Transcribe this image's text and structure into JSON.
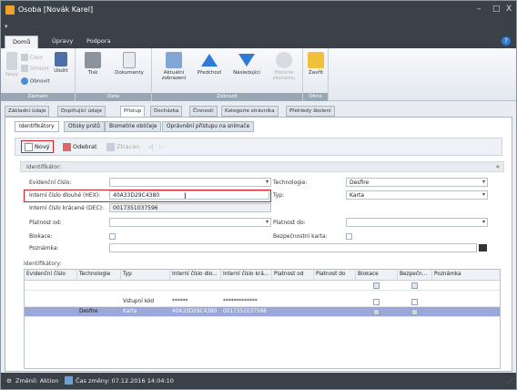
{
  "window": {
    "title": "Osoba [Novák Karel]",
    "controls": [
      "–",
      "□",
      "X"
    ]
  },
  "ribbon_tabs": [
    "Domů",
    "Úpravy",
    "Podpora"
  ],
  "help_label": "?",
  "ribbon": {
    "zaznam": {
      "label": "Záznam",
      "novy": "Nový",
      "copy": "Copy",
      "smazat": "Smazat",
      "ulozit": "Uložit",
      "obnovit": "Obnovit"
    },
    "data": {
      "label": "Data",
      "tisk": "Tisk",
      "dokumenty": "Dokumenty"
    },
    "zobrazit": {
      "label": "Zobrazit",
      "aktualni": "Aktuální zobrazení",
      "predchozi": "Předchozí",
      "nasledujici": "Následující",
      "historie": "Historie záznamu"
    },
    "okno": {
      "label": "Okno",
      "zavrit": "Zavřít"
    }
  },
  "doc_tabs": [
    "Základní údaje",
    "Doplňující údaje",
    "Přístup",
    "Docházka",
    "Činnosti",
    "Kategorie strávníka",
    "Přehledy školení"
  ],
  "sub_tabs": [
    "Identifikátory",
    "Otisky prstů",
    "Biometrie obličeje",
    "Oprávnění přístupu na snímače"
  ],
  "toolbar": {
    "novy": "Nový",
    "odebrat": "Odebrat",
    "ztracen": "Ztracen"
  },
  "section_title": "Identifikátor:",
  "form": {
    "evidencni_label": "Evidenční číslo:",
    "evidencni_value": "",
    "technologie_label": "Technologie:",
    "technologie_value": "Desfire",
    "hex_label": "Interní číslo dlouhé (HEX):",
    "hex_value": "40A33D29C4380",
    "typ_label": "Typ:",
    "typ_value": "Karta",
    "dec_label": "Interní číslo krácené (DEC):",
    "dec_value": "0017351037596",
    "platnost_od_label": "Platnost od:",
    "platnost_do_label": "Platnost do:",
    "blokace_label": "Blokace:",
    "bezpecnostni_label": "Bezpečnostní karta:",
    "poznamka_label": "Poznámka:"
  },
  "grid": {
    "label": "Identifikátory:",
    "headers": [
      "Evidenční číslo",
      "Technologie",
      "Typ",
      "Interní číslo dlo...",
      "Interní číslo krá...",
      "Platnost od",
      "Platnost do",
      "Blokace",
      "Bezpečn...",
      "Poznámka"
    ],
    "rows": [
      {
        "evidencni": "",
        "technologie": "",
        "typ": "Vstupní kód",
        "hex": "******",
        "dec": "*************"
      },
      {
        "evidencni": "",
        "technologie": "Desfire",
        "typ": "Karta",
        "hex": "40A33D29C4380",
        "dec": "0017351037596"
      }
    ]
  },
  "status": {
    "zmenil": "Změnil: Aktion",
    "cas": "Čas změny: 07.12.2016 14:04:10"
  }
}
